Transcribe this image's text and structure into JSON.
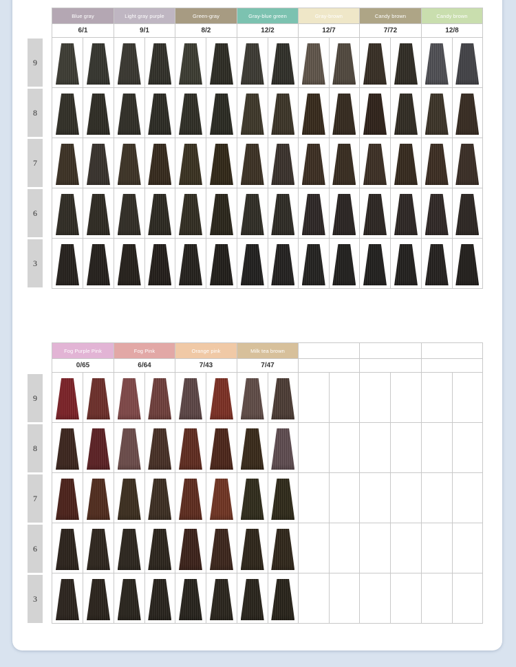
{
  "section1": {
    "headers": [
      {
        "label": "Blue gray",
        "color": "#b4a7b3"
      },
      {
        "label": "Light gray purple",
        "color": "#bfb6c2"
      },
      {
        "label": "Green-gray",
        "color": "#a79b82"
      },
      {
        "label": "Gray-blue green",
        "color": "#7cc2b0"
      },
      {
        "label": "Gray-brown",
        "color": "#efe7c8"
      },
      {
        "label": "Candy brown",
        "color": "#aea586"
      },
      {
        "label": "Candy brown",
        "color": "#c9deae"
      }
    ],
    "codes": [
      "6/1",
      "9/1",
      "8/2",
      "12/2",
      "12/7",
      "7/72",
      "12/8"
    ],
    "levels": [
      "9",
      "8",
      "7",
      "6",
      "3"
    ],
    "swatches": [
      [
        "#3b3a32",
        "#33332c",
        "#37352e",
        "#2f2e27",
        "#3a3a30",
        "#2b2a22",
        "#3a3831",
        "#2e2d27",
        "#5e5348",
        "#4f463c",
        "#352c22",
        "#2e2a22",
        "#4d4d52",
        "#414145"
      ],
      [
        "#2f2d25",
        "#2c2a22",
        "#2e2c25",
        "#2a2922",
        "#2d2c24",
        "#282820",
        "#3c3628",
        "#3a3326",
        "#35281a",
        "#33281d",
        "#2d2018",
        "#2f2a21",
        "#3a3226",
        "#35291f"
      ],
      [
        "#3a2f22",
        "#36302a",
        "#3b3124",
        "#34281b",
        "#38301f",
        "#2f2616",
        "#3a2f22",
        "#38302a",
        "#3a2c20",
        "#362a1e",
        "#3a2d22",
        "#34281c",
        "#3a2b20",
        "#382b23"
      ],
      [
        "#2e2a22",
        "#2c2820",
        "#2f2b24",
        "#2a271f",
        "#302b20",
        "#282419",
        "#2e2b24",
        "#2c2923",
        "#2b2524",
        "#282220",
        "#2a2420",
        "#2b2522",
        "#2e2624",
        "#2a2420"
      ],
      [
        "#241f1b",
        "#221e1a",
        "#231e19",
        "#211c18",
        "#221f1b",
        "#1f1c18",
        "#1f1e1d",
        "#211f1e",
        "#21201e",
        "#1f1e1c",
        "#1f1e1c",
        "#201e1c",
        "#221f1d",
        "#201d1a"
      ]
    ]
  },
  "section2": {
    "headers": [
      {
        "label": "Fog Purple Pink",
        "color": "#e2b4d5"
      },
      {
        "label": "Fog Pink",
        "color": "#e2a8a6"
      },
      {
        "label": "Orange pink",
        "color": "#f0c9a6"
      },
      {
        "label": "Milk tea brown",
        "color": "#d7c09b"
      },
      {
        "label": "",
        "color": "#ffffff"
      },
      {
        "label": "",
        "color": "#ffffff"
      },
      {
        "label": "",
        "color": "#ffffff"
      }
    ],
    "codes": [
      "0/65",
      "6/64",
      "7/43",
      "7/47",
      "",
      "",
      ""
    ],
    "levels": [
      "9",
      "8",
      "7",
      "6",
      "3"
    ],
    "swatches": [
      [
        "#7a2026",
        "#6b2d28",
        "#7e4646",
        "#6d3d3a",
        "#5a4444",
        "#7a2e22",
        "#5e4a45",
        "#4a3a33",
        "",
        "",
        "",
        "",
        "",
        ""
      ],
      [
        "#3a241c",
        "#5a1f22",
        "#6a4a48",
        "#452e24",
        "#5e2a1e",
        "#4a2418",
        "#372818",
        "#5c4a4e",
        "",
        "",
        "",
        "",
        "",
        ""
      ],
      [
        "#4a2019",
        "#4f2a1c",
        "#3a2c1d",
        "#3a2c20",
        "#5c2a1d",
        "#6e3321",
        "#2e2a1a",
        "#2d2818",
        "",
        "",
        "",
        "",
        "",
        ""
      ],
      [
        "#2a211a",
        "#2c241c",
        "#2a241c",
        "#2a231b",
        "#3a2018",
        "#3a241a",
        "#2c2418",
        "#2e2519",
        "",
        "",
        "",
        "",
        "",
        ""
      ],
      [
        "#2a221c",
        "#28211a",
        "#27221b",
        "#26211b",
        "#25211b",
        "#28231b",
        "#27221a",
        "#262118",
        "",
        "",
        "",
        "",
        "",
        ""
      ]
    ]
  }
}
